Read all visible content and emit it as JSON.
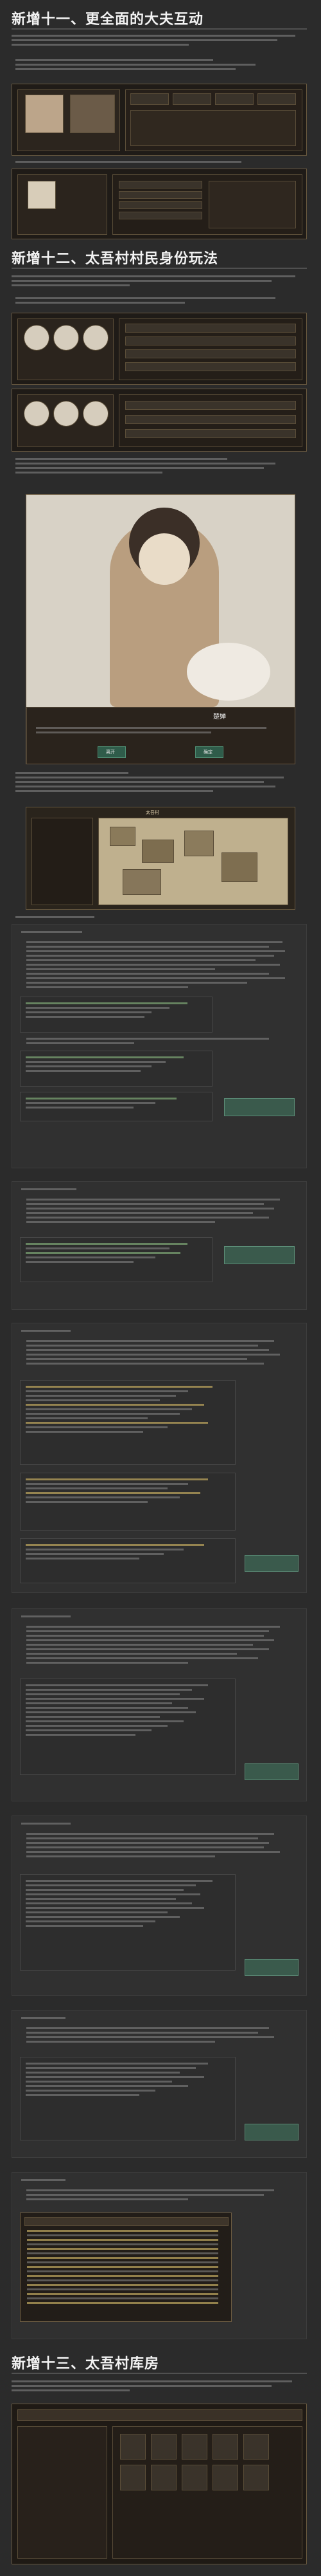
{
  "sections": {
    "s11_title": "新增十一、更全面的大夫互动",
    "s12_title": "新增十二、太吾村村民身份玩法",
    "s13_title": "新增十三、太吾村库房"
  },
  "labels": {
    "portrait_name": "楚婵",
    "btn_left": "离开",
    "btn_right": "确定",
    "map_title": "太吾村"
  },
  "colors": {
    "bg": "#2b2b2b",
    "accent_green": "#4d8a70",
    "accent_gold": "#d9b46a"
  }
}
